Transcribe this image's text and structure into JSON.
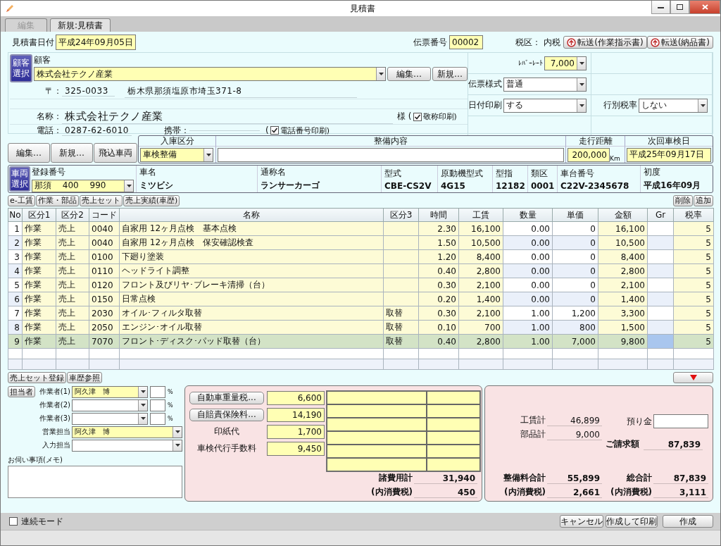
{
  "window": {
    "title": "見積書"
  },
  "tabs": [
    {
      "label": "編集",
      "selected": false
    },
    {
      "label": "新規:見積書",
      "selected": true
    }
  ],
  "header": {
    "date_label": "見積書日付",
    "date": "平成24年09月05日",
    "slip_no_label": "伝票番号",
    "slip_no": "00002",
    "tax_label": "税区：",
    "tax": "内税",
    "transfer_buttons": [
      "転送(作業指示書)",
      "転送(納品書)"
    ]
  },
  "customer": {
    "select_button": "顧客選択",
    "label": "顧客",
    "name_field": "株式会社テクノ産業",
    "edit_button": "編集…",
    "new_button": "新規…",
    "postal_label": "〒：",
    "postal": "325-0033",
    "address": "栃木県那須塩原市埼玉371-8",
    "name_label": "名称：",
    "name": "株式会社テクノ産業",
    "honorific": "様 (",
    "honorific_print": {
      "label": "敬称印刷)",
      "checked": true
    },
    "phone_label": "電話：",
    "phone": "0287-62-6010",
    "mobile_label": "携帯：",
    "phone_print": {
      "prefix": "(",
      "label": "電話番号印刷)",
      "checked": true
    }
  },
  "settings": [
    {
      "label": "ﾚﾊﾞｰﾚｰﾄ",
      "value": "7,000",
      "kind": "number"
    },
    {
      "label": "伝票様式",
      "value": "普通",
      "kind": "select"
    },
    {
      "label": "日付印刷",
      "value": "する",
      "kind": "select"
    },
    {
      "label": "行別税率",
      "value": "しない",
      "kind": "select"
    }
  ],
  "vehicle_buttons": [
    "編集…",
    "新規…",
    "飛込車両"
  ],
  "service": {
    "entry_type_label": "入庫区分",
    "entry_type": "車検整備",
    "content_label": "整備内容",
    "mileage_label": "走行距離",
    "mileage": "200,000",
    "mileage_unit": "Km",
    "next_inspection_label": "次回車検日",
    "next_inspection": "平成25年09月17日"
  },
  "vehicle": {
    "select_button": "車両選択",
    "fields": [
      {
        "label": "登録番号",
        "value": "那須　 400　 990",
        "kind": "select"
      },
      {
        "label": "車名",
        "value": "ミツビシ",
        "kind": "text"
      },
      {
        "label": "通称名",
        "value": "ランサーカーゴ",
        "kind": "text"
      },
      {
        "label": "型式",
        "value": "CBE-CS2V",
        "kind": "text"
      },
      {
        "label": "原動機型式",
        "value": "4G15",
        "kind": "text"
      },
      {
        "label": "型指",
        "value": "12182",
        "kind": "text"
      },
      {
        "label": "類区",
        "value": "0001",
        "kind": "text"
      },
      {
        "label": "車台番号",
        "value": "C22V-2345678",
        "kind": "text"
      },
      {
        "label": "初度",
        "value": "平成16年09月",
        "kind": "text"
      }
    ]
  },
  "detail_tabs": [
    "e-工賃",
    "作業・部品",
    "売上セット",
    "売上実績(車歴)"
  ],
  "table_actions": [
    "削除",
    "追加"
  ],
  "table": {
    "columns": [
      "No",
      "区分1",
      "区分2",
      "コード",
      "名称",
      "区分3",
      "時間",
      "工賃",
      "数量",
      "単価",
      "金額",
      "Gr",
      "税率"
    ],
    "rows": [
      {
        "no": "1",
        "category_1": "作業",
        "category_2": "売上",
        "code": "0040",
        "name": "自家用 12ヶ月点検　基本点検",
        "hours": "2.30",
        "labor": "16,100",
        "quantity": "0.00",
        "unit_price": "0",
        "amount": "16,100",
        "tax_rate": "5",
        "selected": false
      },
      {
        "no": "2",
        "category_1": "作業",
        "category_2": "売上",
        "code": "0040",
        "name": "自家用 12ヶ月点検　保安確認検査",
        "hours": "1.50",
        "labor": "10,500",
        "quantity": "0.00",
        "unit_price": "0",
        "amount": "10,500",
        "tax_rate": "5",
        "selected": false
      },
      {
        "no": "3",
        "category_1": "作業",
        "category_2": "売上",
        "code": "0100",
        "name": "下廻り塗装",
        "hours": "1.20",
        "labor": "8,400",
        "quantity": "0.00",
        "unit_price": "0",
        "amount": "8,400",
        "tax_rate": "5",
        "selected": false
      },
      {
        "no": "4",
        "category_1": "作業",
        "category_2": "売上",
        "code": "0110",
        "name": "ヘッドライト調整",
        "hours": "0.40",
        "labor": "2,800",
        "quantity": "0.00",
        "unit_price": "0",
        "amount": "2,800",
        "tax_rate": "5",
        "selected": false
      },
      {
        "no": "5",
        "category_1": "作業",
        "category_2": "売上",
        "code": "0120",
        "name": "フロント及びリヤ･ブレーキ清掃（台）",
        "hours": "0.30",
        "labor": "2,100",
        "quantity": "0.00",
        "unit_price": "0",
        "amount": "2,100",
        "tax_rate": "5",
        "selected": false
      },
      {
        "no": "6",
        "category_1": "作業",
        "category_2": "売上",
        "code": "0150",
        "name": "日常点検",
        "hours": "0.20",
        "labor": "1,400",
        "quantity": "0.00",
        "unit_price": "0",
        "amount": "1,400",
        "tax_rate": "5",
        "selected": false
      },
      {
        "no": "7",
        "category_1": "作業",
        "category_2": "売上",
        "code": "2030",
        "name": "オイル･フィルタ取替",
        "category_3": "取替",
        "hours": "0.30",
        "labor": "2,100",
        "quantity": "1.00",
        "unit_price": "1,200",
        "amount": "3,300",
        "tax_rate": "5",
        "selected": false
      },
      {
        "no": "8",
        "category_1": "作業",
        "category_2": "売上",
        "code": "2050",
        "name": "エンジン･オイル取替",
        "category_3": "取替",
        "hours": "0.10",
        "labor": "700",
        "quantity": "1.00",
        "unit_price": "800",
        "amount": "1,500",
        "tax_rate": "5",
        "selected": false
      },
      {
        "no": "9",
        "category_1": "作業",
        "category_2": "売上",
        "code": "7070",
        "name": "フロント･ディスク･パッド取替（台）",
        "category_3": "取替",
        "hours": "0.40",
        "labor": "2,800",
        "quantity": "1.00",
        "unit_price": "7,000",
        "amount": "9,800",
        "tax_rate": "5",
        "selected": true
      }
    ]
  },
  "below_table_buttons": [
    "売上セット登録",
    "車歴参照"
  ],
  "staff": {
    "button": "担当者",
    "workers": [
      {
        "label": "作業者(1)",
        "value": "阿久津　博",
        "unit": "%"
      },
      {
        "label": "作業者(2)",
        "unit": "%"
      },
      {
        "label": "作業者(3)",
        "unit": "%"
      }
    ],
    "sales": {
      "label": "営業担当",
      "value": "阿久津　博"
    },
    "input": {
      "label": "入力担当"
    },
    "memo_label": "お伺い事項(メモ)"
  },
  "fees": {
    "items": [
      {
        "kind": "button",
        "label": "自動車重量税...",
        "value": "6,600"
      },
      {
        "kind": "button",
        "label": "自賠責保険料...",
        "value": "14,190"
      },
      {
        "kind": "label",
        "label": "印紙代",
        "value": "1,700"
      },
      {
        "kind": "label",
        "label": "車検代行手数料",
        "value": "9,450"
      }
    ],
    "total_label": "諸費用計",
    "total": "31,940",
    "tax_label": "(内消費税)",
    "tax": "450"
  },
  "totals": {
    "labor_label": "工賃計",
    "labor": "46,899",
    "parts_label": "部品計",
    "parts": "9,000",
    "deposit_label": "預り金",
    "billing_label": "ご請求額",
    "billing": "87,839",
    "service_total_label": "整備料合計",
    "service_total": "55,899",
    "service_tax_label": "(内消費税)",
    "service_tax": "2,661",
    "grand_total_label": "総合計",
    "grand_total": "87,839",
    "grand_tax_label": "(内消費税)",
    "grand_tax": "3,111"
  },
  "footer": {
    "continuous_mode": {
      "label": "連続モード",
      "checked": false
    },
    "buttons": [
      "キャンセル",
      "作成して印刷",
      "作成"
    ]
  }
}
